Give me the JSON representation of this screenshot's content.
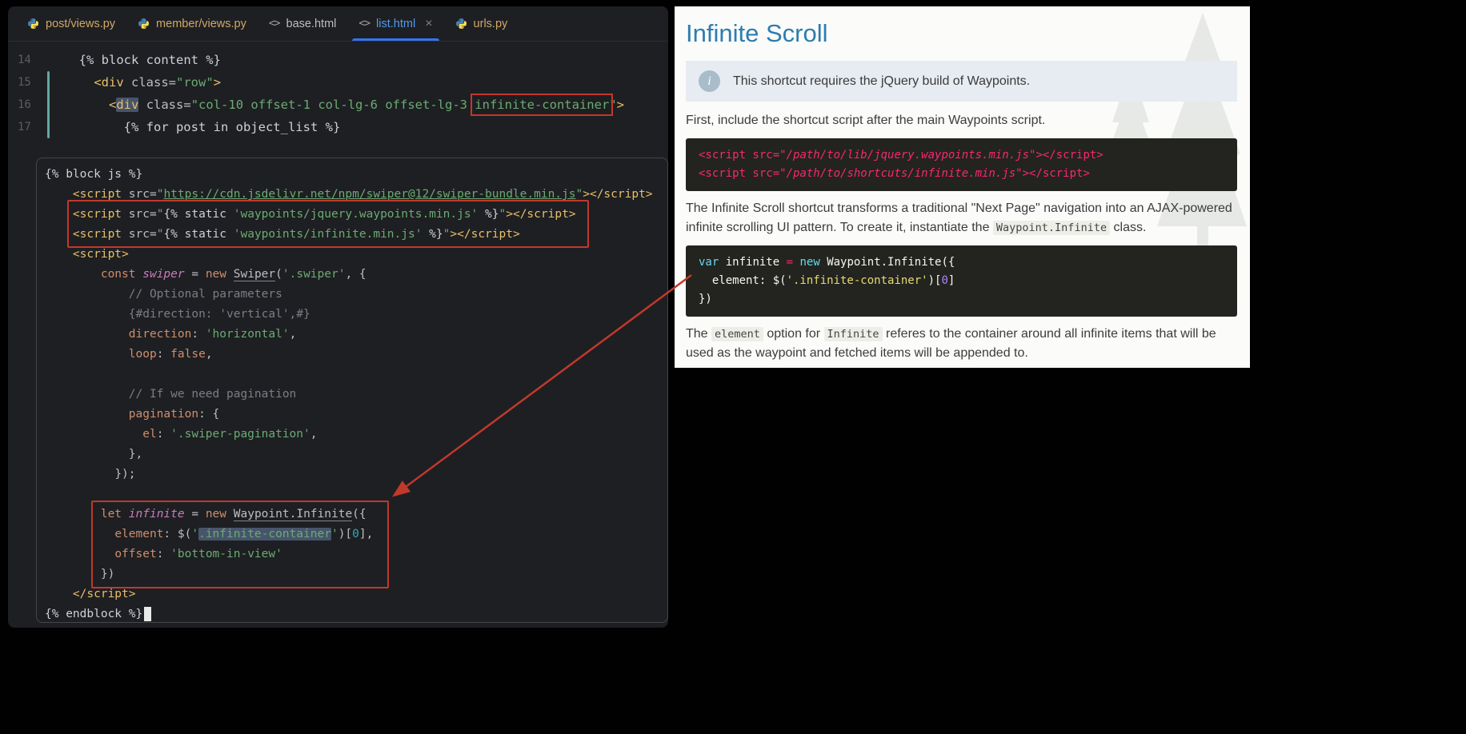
{
  "annotations": {
    "color": "#c0392b"
  },
  "editor": {
    "tabs": [
      {
        "label": "post/views.py",
        "icon": "python",
        "color": "#cfa968",
        "active": false
      },
      {
        "label": "member/views.py",
        "icon": "python",
        "color": "#cfa968",
        "active": false
      },
      {
        "label": "base.html",
        "icon": "html",
        "color": "#bcbec4",
        "active": false
      },
      {
        "label": "list.html",
        "icon": "html",
        "color": "#4f9bf0",
        "active": true,
        "close_label": "×"
      },
      {
        "label": "urls.py",
        "icon": "python",
        "color": "#cfa968",
        "active": false
      }
    ],
    "top_section": {
      "lines": [
        {
          "num": "14",
          "tokens": [
            {
              "t": "  "
            },
            {
              "t": "{% block content %}",
              "c": "tpl"
            }
          ]
        },
        {
          "num": "15",
          "tokens": [
            {
              "t": "    "
            },
            {
              "t": "<div",
              "c": "tag"
            },
            {
              "t": " ",
              "c": "plain"
            },
            {
              "t": "class",
              "c": "attr"
            },
            {
              "t": "=",
              "c": "attr"
            },
            {
              "t": "\"row\"",
              "c": "str"
            },
            {
              "t": ">",
              "c": "tag"
            }
          ]
        },
        {
          "num": "16",
          "tokens": [
            {
              "t": "      "
            },
            {
              "t": "<",
              "c": "tag"
            },
            {
              "t": "div",
              "c": "tag",
              "hl": true
            },
            {
              "t": " ",
              "c": "plain"
            },
            {
              "t": "class",
              "c": "attr"
            },
            {
              "t": "=",
              "c": "attr"
            },
            {
              "t": "\"col-10 offset-1 col-lg-6 offset-lg-3 ",
              "c": "str"
            },
            {
              "t": "infinite-container",
              "c": "str",
              "box": true
            },
            {
              "t": "\"",
              "c": "str"
            },
            {
              "t": ">",
              "c": "tag"
            }
          ]
        },
        {
          "num": "17",
          "tokens": [
            {
              "t": "        "
            },
            {
              "t": "{% for post in object_list %}",
              "c": "tpl"
            }
          ]
        }
      ]
    },
    "bottom_section": {
      "lines": [
        {
          "tokens": [
            {
              "t": "{% block js %}",
              "c": "tpl"
            }
          ]
        },
        {
          "tokens": [
            {
              "t": "    "
            },
            {
              "t": "<script",
              "c": "tag"
            },
            {
              "t": " ",
              "c": "plain"
            },
            {
              "t": "src",
              "c": "attr"
            },
            {
              "t": "=",
              "c": "attr"
            },
            {
              "t": "\"",
              "c": "str"
            },
            {
              "t": "https://cdn.jsdelivr.net/npm/swiper@12/swiper-bundle.min.js",
              "c": "str",
              "link": true
            },
            {
              "t": "\"",
              "c": "str"
            },
            {
              "t": ">",
              "c": "tag"
            },
            {
              "t": "</script>",
              "c": "tag"
            }
          ]
        },
        {
          "tokens": [
            {
              "t": "    "
            },
            {
              "t": "<script",
              "c": "tag"
            },
            {
              "t": " ",
              "c": "plain"
            },
            {
              "t": "src",
              "c": "attr"
            },
            {
              "t": "=",
              "c": "attr"
            },
            {
              "t": "\"",
              "c": "str"
            },
            {
              "t": "{% static ",
              "c": "tpl"
            },
            {
              "t": "'waypoints/jquery.waypoints.min.js'",
              "c": "str"
            },
            {
              "t": " %}",
              "c": "tpl"
            },
            {
              "t": "\"",
              "c": "str"
            },
            {
              "t": ">",
              "c": "tag"
            },
            {
              "t": "</script>",
              "c": "tag"
            }
          ]
        },
        {
          "tokens": [
            {
              "t": "    "
            },
            {
              "t": "<script",
              "c": "tag"
            },
            {
              "t": " ",
              "c": "plain"
            },
            {
              "t": "src",
              "c": "attr"
            },
            {
              "t": "=",
              "c": "attr"
            },
            {
              "t": "\"",
              "c": "str"
            },
            {
              "t": "{% static ",
              "c": "tpl"
            },
            {
              "t": "'waypoints/infinite.min.js'",
              "c": "str"
            },
            {
              "t": " %}",
              "c": "tpl"
            },
            {
              "t": "\"",
              "c": "str"
            },
            {
              "t": ">",
              "c": "tag"
            },
            {
              "t": "</script>",
              "c": "tag"
            }
          ]
        },
        {
          "tokens": [
            {
              "t": "    "
            },
            {
              "t": "<script>",
              "c": "tag"
            }
          ]
        },
        {
          "tokens": [
            {
              "t": "        "
            },
            {
              "t": "const",
              "c": "kw"
            },
            {
              "t": " ",
              "c": "plain"
            },
            {
              "t": "swiper",
              "c": "var"
            },
            {
              "t": " = ",
              "c": "plain"
            },
            {
              "t": "new",
              "c": "kw"
            },
            {
              "t": " ",
              "c": "plain"
            },
            {
              "t": "Swiper",
              "c": "plain",
              "ul": true
            },
            {
              "t": "(",
              "c": "plain"
            },
            {
              "t": "'.swiper'",
              "c": "str"
            },
            {
              "t": ", {",
              "c": "plain"
            }
          ]
        },
        {
          "tokens": [
            {
              "t": "            "
            },
            {
              "t": "// Optional parameters",
              "c": "cmt"
            }
          ]
        },
        {
          "tokens": [
            {
              "t": "            "
            },
            {
              "t": "{#direction: 'vertical',#}",
              "c": "cmt"
            }
          ]
        },
        {
          "tokens": [
            {
              "t": "            "
            },
            {
              "t": "direction",
              "c": "prop"
            },
            {
              "t": ": ",
              "c": "plain"
            },
            {
              "t": "'horizontal'",
              "c": "str"
            },
            {
              "t": ",",
              "c": "plain"
            }
          ]
        },
        {
          "tokens": [
            {
              "t": "            "
            },
            {
              "t": "loop",
              "c": "prop"
            },
            {
              "t": ": ",
              "c": "plain"
            },
            {
              "t": "false",
              "c": "kw"
            },
            {
              "t": ",",
              "c": "plain"
            }
          ]
        },
        {
          "tokens": [
            {
              "t": ""
            }
          ]
        },
        {
          "tokens": [
            {
              "t": "            "
            },
            {
              "t": "// If we need pagination",
              "c": "cmt"
            }
          ]
        },
        {
          "tokens": [
            {
              "t": "            "
            },
            {
              "t": "pagination",
              "c": "prop"
            },
            {
              "t": ": {",
              "c": "plain"
            }
          ]
        },
        {
          "tokens": [
            {
              "t": "              "
            },
            {
              "t": "el",
              "c": "prop"
            },
            {
              "t": ": ",
              "c": "plain"
            },
            {
              "t": "'.swiper-pagination'",
              "c": "str"
            },
            {
              "t": ",",
              "c": "plain"
            }
          ]
        },
        {
          "tokens": [
            {
              "t": "            "
            },
            {
              "t": "},",
              "c": "plain"
            }
          ]
        },
        {
          "tokens": [
            {
              "t": "          "
            },
            {
              "t": "});",
              "c": "plain"
            }
          ]
        },
        {
          "tokens": [
            {
              "t": ""
            }
          ]
        },
        {
          "tokens": [
            {
              "t": "        "
            },
            {
              "t": "let",
              "c": "kw"
            },
            {
              "t": " ",
              "c": "plain"
            },
            {
              "t": "infinite",
              "c": "var"
            },
            {
              "t": " = ",
              "c": "plain"
            },
            {
              "t": "new",
              "c": "kw"
            },
            {
              "t": " ",
              "c": "plain"
            },
            {
              "t": "Waypoint.Infinite",
              "c": "plain",
              "ul": true
            },
            {
              "t": "({",
              "c": "plain"
            }
          ]
        },
        {
          "tokens": [
            {
              "t": "          "
            },
            {
              "t": "element",
              "c": "prop"
            },
            {
              "t": ": ",
              "c": "plain"
            },
            {
              "t": "$(",
              "c": "plain"
            },
            {
              "t": "'",
              "c": "str"
            },
            {
              "t": ".infinite-container",
              "c": "str",
              "hl": true
            },
            {
              "t": "'",
              "c": "str"
            },
            {
              "t": ")[",
              "c": "plain"
            },
            {
              "t": "0",
              "c": "num"
            },
            {
              "t": "],",
              "c": "plain"
            }
          ]
        },
        {
          "tokens": [
            {
              "t": "          "
            },
            {
              "t": "offset",
              "c": "prop"
            },
            {
              "t": ": ",
              "c": "plain"
            },
            {
              "t": "'bottom-in-view'",
              "c": "str"
            }
          ]
        },
        {
          "tokens": [
            {
              "t": "        "
            },
            {
              "t": "})",
              "c": "plain"
            }
          ]
        },
        {
          "tokens": [
            {
              "t": "    "
            },
            {
              "t": "</script>",
              "c": "tag"
            }
          ]
        },
        {
          "caret": true,
          "tokens": [
            {
              "t": "{% endblock %}",
              "c": "tpl"
            }
          ]
        }
      ]
    }
  },
  "doc": {
    "title": "Infinite Scroll",
    "info_icon_glyph": "i",
    "info_note": "This shortcut requires the jQuery build of Waypoints.",
    "para1": "First, include the shortcut script after the main Waypoints script.",
    "code1_lines": [
      [
        {
          "t": "<script src=",
          "c": "pink"
        },
        {
          "t": "\"/path/to/lib/jquery.waypoints.min.js\"",
          "c": "pinkIt"
        },
        {
          "t": "></script>",
          "c": "pink"
        }
      ],
      [
        {
          "t": "<script src=",
          "c": "pink"
        },
        {
          "t": "\"/path/to/shortcuts/infinite.min.js\"",
          "c": "pinkIt"
        },
        {
          "t": "></script>",
          "c": "pink"
        }
      ]
    ],
    "para2_parts": [
      {
        "t": "The Infinite Scroll shortcut transforms a traditional \"Next Page\" navigation into an AJAX-powered infinite scrolling UI pattern. To create it, instantiate the "
      },
      {
        "t": "Waypoint.Infinite",
        "code": true
      },
      {
        "t": " class."
      }
    ],
    "code2_lines": [
      [
        {
          "t": "var",
          "c": "cyan"
        },
        {
          "t": " infinite ",
          "c": "white"
        },
        {
          "t": "=",
          "c": "pink"
        },
        {
          "t": " ",
          "c": "white"
        },
        {
          "t": "new",
          "c": "cyan"
        },
        {
          "t": " Waypoint.Infinite({",
          "c": "white"
        }
      ],
      [
        {
          "t": "  element: $(",
          "c": "white"
        },
        {
          "t": "'.infinite-container'",
          "c": "yellow"
        },
        {
          "t": ")[",
          "c": "white"
        },
        {
          "t": "0",
          "c": "purple"
        },
        {
          "t": "]",
          "c": "white"
        }
      ],
      [
        {
          "t": "})",
          "c": "white"
        }
      ]
    ],
    "para3_parts": [
      {
        "t": "The "
      },
      {
        "t": "element",
        "code": true
      },
      {
        "t": " option for "
      },
      {
        "t": "Infinite",
        "code": true
      },
      {
        "t": " referes to the container around all infinite items that will be used as the waypoint and fetched items will be appended to."
      }
    ]
  }
}
